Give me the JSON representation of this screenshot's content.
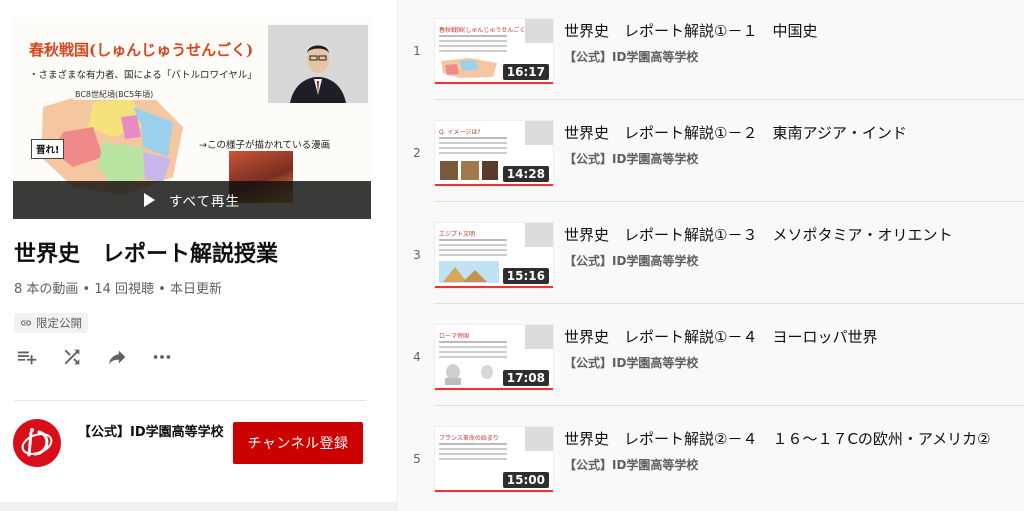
{
  "playlist": {
    "hero_thumbnail": {
      "slide_title": "春秋戦国(しゅんじゅうせんごく)",
      "slide_subtitle": "・さまざまな有力者、国による「バトルロワイヤル」",
      "map_caption": "BC8世紀頃(BC5年頃)",
      "callout": "晋れ!",
      "arrow_text": "→この様子が描かれている漫画"
    },
    "play_all_label": "すべて再生",
    "title": "世界史　レポート解説授業",
    "meta": "8 本の動画 • 14 回視聴 • 本日更新",
    "privacy": "限定公開",
    "actions": [
      "add-to-queue-icon",
      "shuffle-icon",
      "share-icon",
      "more-icon"
    ]
  },
  "channel": {
    "name": "【公式】ID学園高等学校",
    "subscribe_label": "チャンネル登録",
    "avatar_logo": "iD"
  },
  "colors": {
    "accent_red": "#cc0000",
    "text_primary": "#0f0f0f",
    "text_secondary": "#606060"
  },
  "videos": [
    {
      "index": "1",
      "title": "世界史　レポート解説①－１　中国史",
      "channel": "【公式】ID学園高等学校",
      "duration": "16:17",
      "thumb_title": "春秋戦国(しゅんじゅうせんごく)"
    },
    {
      "index": "2",
      "title": "世界史　レポート解説①－２　東南アジア・インド",
      "channel": "【公式】ID学園高等学校",
      "duration": "14:28",
      "thumb_title": "Q. イメージは?"
    },
    {
      "index": "3",
      "title": "世界史　レポート解説①－３　メソポタミア・オリエント",
      "channel": "【公式】ID学園高等学校",
      "duration": "15:16",
      "thumb_title": "エジプト文明"
    },
    {
      "index": "4",
      "title": "世界史　レポート解説①－４　ヨーロッパ世界",
      "channel": "【公式】ID学園高等学校",
      "duration": "17:08",
      "thumb_title": "ローマ帝国"
    },
    {
      "index": "5",
      "title": "世界史　レポート解説②－４　１６～１７Cの欧州・アメリカ②",
      "channel": "【公式】ID学園高等学校",
      "duration": "15:00",
      "thumb_title": "フランス革命の始まり"
    }
  ]
}
